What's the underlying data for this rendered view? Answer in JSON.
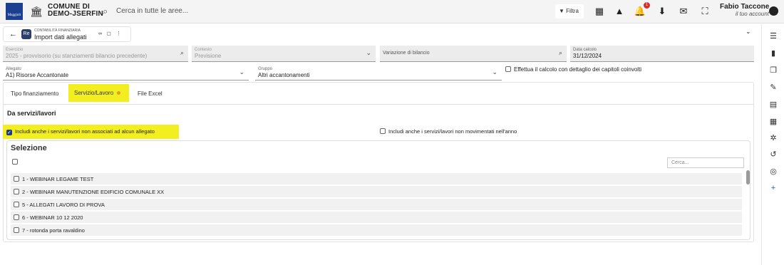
{
  "header": {
    "logo_text": "Maggioli",
    "org_name": "COMUNE DI\nDEMO-JSERFIN",
    "search_placeholder": "Cerca in tutte le aree...",
    "filter_label": "Filtra",
    "notification_count": "1",
    "user_name": "Fabio Tacconell...",
    "user_sub": "il tuo account",
    "icons": [
      "grid-icon",
      "alert-icon",
      "bell-icon",
      "download-icon",
      "mail-icon",
      "fullscreen-icon",
      "user-icon"
    ]
  },
  "breadcrumb": {
    "module": "CONTABILITÀ FINANZIARIA",
    "title": "Import dati allegati",
    "app_badge": "Re"
  },
  "filters": {
    "esercizio_label": "Esercizio",
    "esercizio_value": "2025 - provvisorio (su stanziamenti bilancio precedente)",
    "contesto_label": "Contesto",
    "contesto_value": "Previsione",
    "variazione_placeholder": "Variazione di bilancio",
    "data_label": "Data calcolo",
    "data_value": "31/12/2024",
    "allegato_label": "Allegato",
    "allegato_value": "A1) Risorse Accantonate",
    "gruppo_label": "Gruppo",
    "gruppo_value": "Altri accantonamenti",
    "dettaglio_label": "Effettua il calcolo con dettaglio dei capitoli coinvolti"
  },
  "tabs": [
    "Tipo finanziamento",
    "Servizio/Lavoro",
    "File Excel"
  ],
  "section_title": "Da servizi/lavori",
  "options": {
    "include_unassoc": "Includi anche i servizi/lavori non associati ad alcun allegato",
    "include_unmoved": "Includi anche i servizi/lavori non movimentati nell'anno"
  },
  "selection": {
    "title": "Selezione",
    "search_placeholder": "Cerca...",
    "items": [
      "1 - WEBINAR LEGAME TEST",
      "2 - WEBINAR MANUTENZIONE EDIFICIO COMUNALE XX",
      "5 - ALLEGATI LAVORO DI PROVA",
      "6 - WEBINAR 10 12 2020",
      "7 - rotonda porta ravaldino"
    ]
  },
  "colors": {
    "highlight": "#f2ee20",
    "brand": "#1d3f8f",
    "badge": "#d32f2f"
  }
}
